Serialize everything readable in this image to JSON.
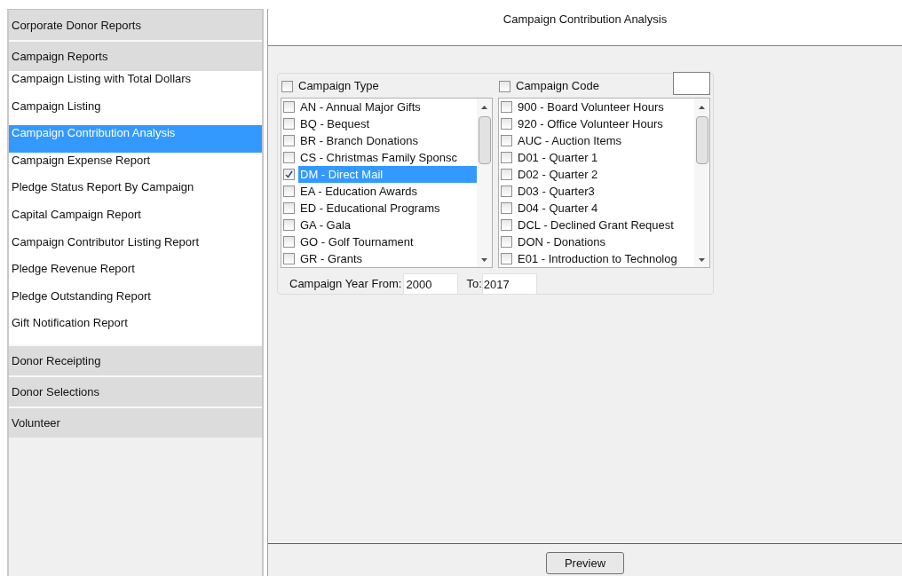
{
  "sidebar": {
    "sections": [
      {
        "label": "Corporate Donor Reports"
      },
      {
        "label": "Campaign Reports",
        "items": [
          {
            "label": "Campaign Listing with Total Dollars",
            "selected": false
          },
          {
            "label": "Campaign Listing",
            "selected": false
          },
          {
            "label": "Campaign Contribution Analysis",
            "selected": true
          },
          {
            "label": "Campaign Expense Report",
            "selected": false
          },
          {
            "label": "Pledge Status Report By Campaign",
            "selected": false
          },
          {
            "label": "Capital Campaign Report",
            "selected": false
          },
          {
            "label": "Campaign Contributor Listing Report",
            "selected": false
          },
          {
            "label": "Pledge Revenue Report",
            "selected": false
          },
          {
            "label": "Pledge Outstanding Report",
            "selected": false
          },
          {
            "label": "Gift Notification Report",
            "selected": false
          }
        ]
      },
      {
        "label": "Donor Receipting"
      },
      {
        "label": "Donor Selections"
      },
      {
        "label": "Volunteer"
      }
    ]
  },
  "report_title": "Campaign Contribution Analysis",
  "lists": [
    {
      "label": "Campaign Type",
      "checked": false,
      "items": [
        {
          "label": "AN - Annual Major Gifts",
          "checked": false,
          "selected": false
        },
        {
          "label": "BQ - Bequest",
          "checked": false,
          "selected": false
        },
        {
          "label": "BR - Branch Donations",
          "checked": false,
          "selected": false
        },
        {
          "label": "CS - Christmas Family Sponsc",
          "checked": false,
          "selected": false
        },
        {
          "label": "DM - Direct Mail",
          "checked": true,
          "selected": true
        },
        {
          "label": "EA - Education Awards",
          "checked": false,
          "selected": false
        },
        {
          "label": "ED - Educational Programs",
          "checked": false,
          "selected": false
        },
        {
          "label": "GA - Gala",
          "checked": false,
          "selected": false
        },
        {
          "label": "GO - Golf Tournament",
          "checked": false,
          "selected": false
        },
        {
          "label": "GR - Grants",
          "checked": false,
          "selected": false
        }
      ]
    },
    {
      "label": "Campaign Code",
      "checked": false,
      "items": [
        {
          "label": "900 - Board Volunteer Hours",
          "checked": false,
          "selected": false
        },
        {
          "label": "920 - Office Volunteer Hours",
          "checked": false,
          "selected": false
        },
        {
          "label": "AUC - Auction Items",
          "checked": false,
          "selected": false
        },
        {
          "label": "D01 - Quarter 1",
          "checked": false,
          "selected": false
        },
        {
          "label": "D02 - Quarter 2",
          "checked": false,
          "selected": false
        },
        {
          "label": "D03 - Quarter3",
          "checked": false,
          "selected": false
        },
        {
          "label": "D04 - Quarter 4",
          "checked": false,
          "selected": false
        },
        {
          "label": "DCL - Declined Grant Request",
          "checked": false,
          "selected": false
        },
        {
          "label": "DON - Donations",
          "checked": false,
          "selected": false
        },
        {
          "label": "E01 - Introduction to Technolog",
          "checked": false,
          "selected": false
        }
      ]
    }
  ],
  "year_from": {
    "label": "Campaign Year From:",
    "value": "2000"
  },
  "year_to": {
    "label": "To:",
    "value": "2017"
  },
  "preview_button": "Preview"
}
